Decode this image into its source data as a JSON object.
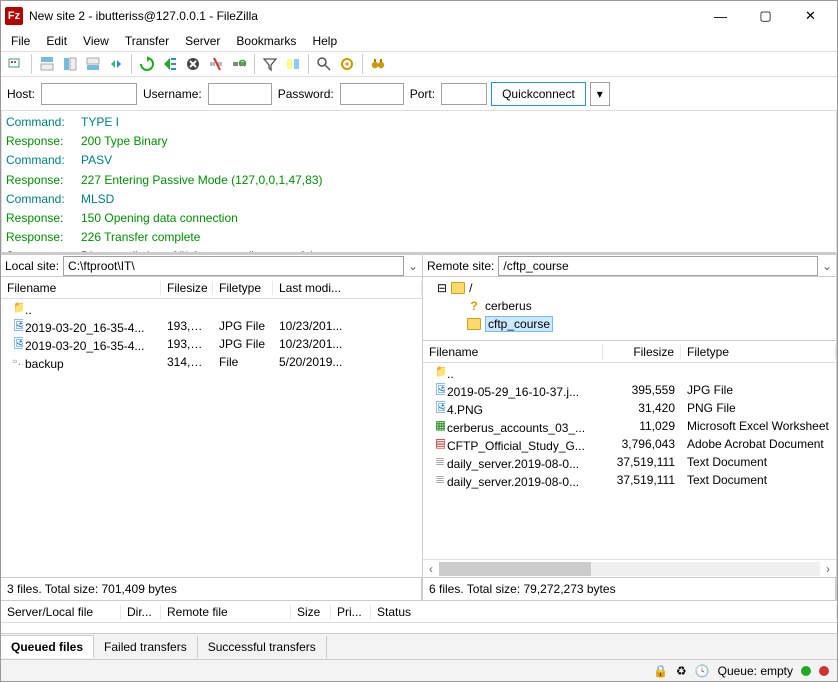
{
  "window": {
    "title": "New site 2 - ibutteriss@127.0.0.1 - FileZilla"
  },
  "menu": {
    "items": [
      "File",
      "Edit",
      "View",
      "Transfer",
      "Server",
      "Bookmarks",
      "Help"
    ]
  },
  "qc": {
    "host_label": "Host:",
    "username_label": "Username:",
    "password_label": "Password:",
    "port_label": "Port:",
    "host": "",
    "username": "",
    "password": "",
    "port": "",
    "button": "Quickconnect"
  },
  "log": [
    {
      "label": "Command:",
      "cls": "teal",
      "msg": "TYPE I"
    },
    {
      "label": "Response:",
      "cls": "green",
      "msg": "200 Type Binary"
    },
    {
      "label": "Command:",
      "cls": "teal",
      "msg": "PASV"
    },
    {
      "label": "Response:",
      "cls": "green",
      "msg": "227 Entering Passive Mode (127,0,0,1,47,83)"
    },
    {
      "label": "Command:",
      "cls": "teal",
      "msg": "MLSD"
    },
    {
      "label": "Response:",
      "cls": "green",
      "msg": "150 Opening data connection"
    },
    {
      "label": "Response:",
      "cls": "green",
      "msg": "226 Transfer complete"
    },
    {
      "label": "Status:",
      "cls": "black",
      "msg": "Directory listing of \"/cftp_course\" successful"
    }
  ],
  "local": {
    "label": "Local site:",
    "path": "C:\\ftproot\\IT\\",
    "columns": [
      "Filename",
      "Filesize",
      "Filetype",
      "Last modi..."
    ],
    "rows": [
      {
        "icon": "folder",
        "name": "..",
        "size": "",
        "type": "",
        "mod": ""
      },
      {
        "icon": "jpg",
        "name": "2019-03-20_16-35-4...",
        "size": "193,5...",
        "type": "JPG File",
        "mod": "10/23/201..."
      },
      {
        "icon": "jpg",
        "name": "2019-03-20_16-35-4...",
        "size": "193,5...",
        "type": "JPG File",
        "mod": "10/23/201..."
      },
      {
        "icon": "generic",
        "name": "backup",
        "size": "314,3...",
        "type": "File",
        "mod": "5/20/2019..."
      }
    ],
    "status": "3 files. Total size: 701,409 bytes"
  },
  "remote": {
    "label": "Remote site:",
    "path": "/cftp_course",
    "tree": {
      "root": "/",
      "children": [
        "cerberus",
        "cftp_course"
      ],
      "selected": "cftp_course"
    },
    "columns": [
      "Filename",
      "Filesize",
      "Filetype"
    ],
    "rows": [
      {
        "icon": "folder",
        "name": "..",
        "size": "",
        "type": ""
      },
      {
        "icon": "jpg",
        "name": "2019-05-29_16-10-37.j...",
        "size": "395,559",
        "type": "JPG File"
      },
      {
        "icon": "png",
        "name": "4.PNG",
        "size": "31,420",
        "type": "PNG File"
      },
      {
        "icon": "xls",
        "name": "cerberus_accounts_03_...",
        "size": "11,029",
        "type": "Microsoft Excel Worksheet"
      },
      {
        "icon": "pdf",
        "name": "CFTP_Official_Study_G...",
        "size": "3,796,043",
        "type": "Adobe Acrobat Document"
      },
      {
        "icon": "txt",
        "name": "daily_server.2019-08-0...",
        "size": "37,519,111",
        "type": "Text Document"
      },
      {
        "icon": "txt",
        "name": "daily_server.2019-08-0...",
        "size": "37,519,111",
        "type": "Text Document"
      }
    ],
    "status": "6 files. Total size: 79,272,273 bytes"
  },
  "queue": {
    "columns": [
      "Server/Local file",
      "Dir...",
      "Remote file",
      "Size",
      "Pri...",
      "Status"
    ],
    "tabs": [
      "Queued files",
      "Failed transfers",
      "Successful transfers"
    ],
    "active_tab": "Queued files"
  },
  "statusbar": {
    "queue": "Queue: empty"
  }
}
